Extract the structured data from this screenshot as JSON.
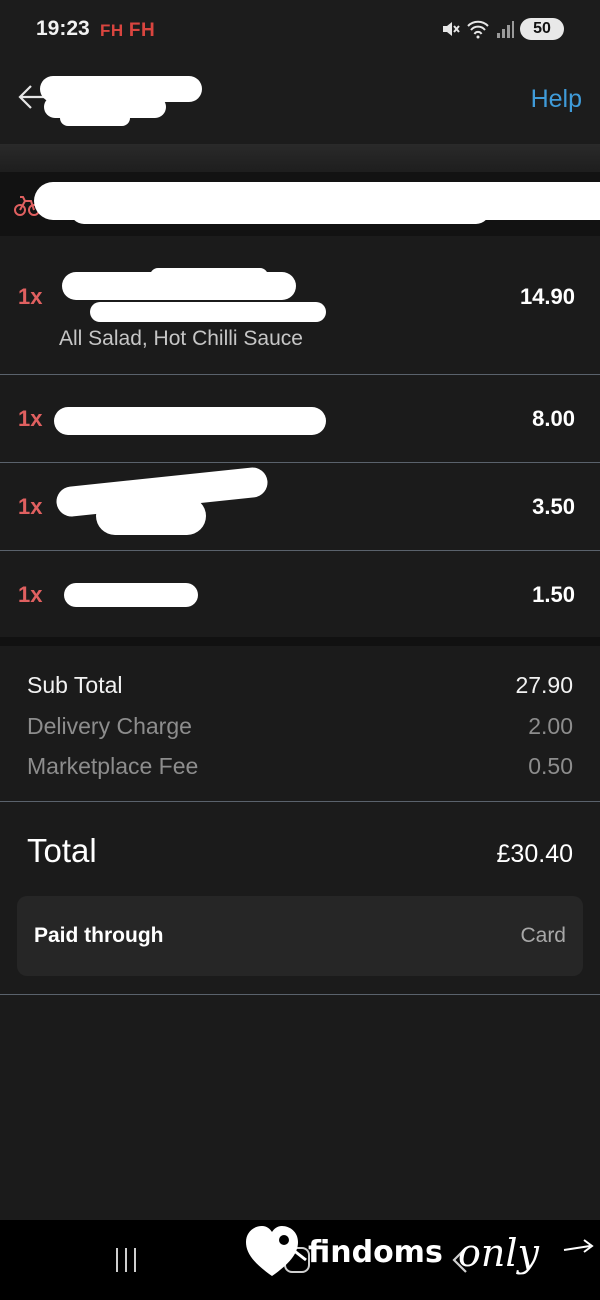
{
  "status_bar": {
    "time": "19:23",
    "flag_1": "FH",
    "flag_2": "FH",
    "battery": "50"
  },
  "header": {
    "help_label": "Help"
  },
  "items": [
    {
      "qty": "1x",
      "price": "14.90",
      "modifiers": "All Salad, Hot Chilli Sauce"
    },
    {
      "qty": "1x",
      "price": "8.00"
    },
    {
      "qty": "1x",
      "price": "3.50"
    },
    {
      "qty": "1x",
      "price": "1.50"
    }
  ],
  "totals": {
    "subtotal_label": "Sub Total",
    "subtotal_value": "27.90",
    "delivery_label": "Delivery Charge",
    "delivery_value": "2.00",
    "marketplace_label": "Marketplace Fee",
    "marketplace_value": "0.50",
    "total_label": "Total",
    "total_value": "£30.40"
  },
  "payment": {
    "label": "Paid through",
    "value": "Card"
  },
  "watermark": {
    "brand_bold": "findoms",
    "brand_script": "only"
  },
  "colors": {
    "background": "#1b1b1b",
    "accent_link": "#3f9bd9",
    "quantity_red": "#e06060",
    "divider": "#5a626c"
  },
  "icons": [
    "back-arrow-icon",
    "mute-icon",
    "wifi-icon",
    "signal-icon",
    "bike-icon",
    "recents-icon",
    "home-icon",
    "nav-back-icon",
    "heart-tag-icon"
  ]
}
